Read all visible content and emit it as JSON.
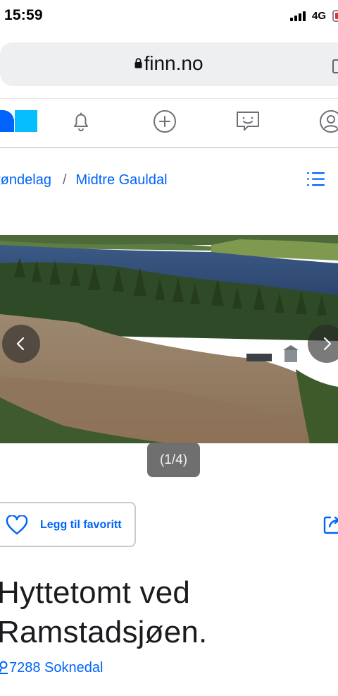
{
  "status_bar": {
    "time": "15:59",
    "network": "4G",
    "battery_color": "#e0302b"
  },
  "browser": {
    "url": "finn.no",
    "lock_icon": "lock-icon"
  },
  "finn_nav": {
    "logo_colors": [
      "#0063fb",
      "#06befb"
    ],
    "icons": [
      "bell-icon",
      "plus-circle-icon",
      "chat-icon",
      "profile-icon"
    ]
  },
  "breadcrumb": {
    "items": [
      "røndelag",
      "Midtre Gauldal"
    ],
    "separator": "/",
    "menu_icon": "list-icon"
  },
  "gallery": {
    "counter": "(1/4)",
    "prev_icon": "chevron-left-icon",
    "next_icon": "chevron-right-icon"
  },
  "actions": {
    "favorite_label": "Legg til favoritt",
    "favorite_icon": "heart-icon",
    "share_icon": "share-icon"
  },
  "listing": {
    "title": "Hyttetomt ved Ramstadsjøen.",
    "location": "7288 Soknedal",
    "location_icon": "map-pin-icon"
  },
  "colors": {
    "accent": "#0063fb",
    "text": "#1b1b1f"
  }
}
